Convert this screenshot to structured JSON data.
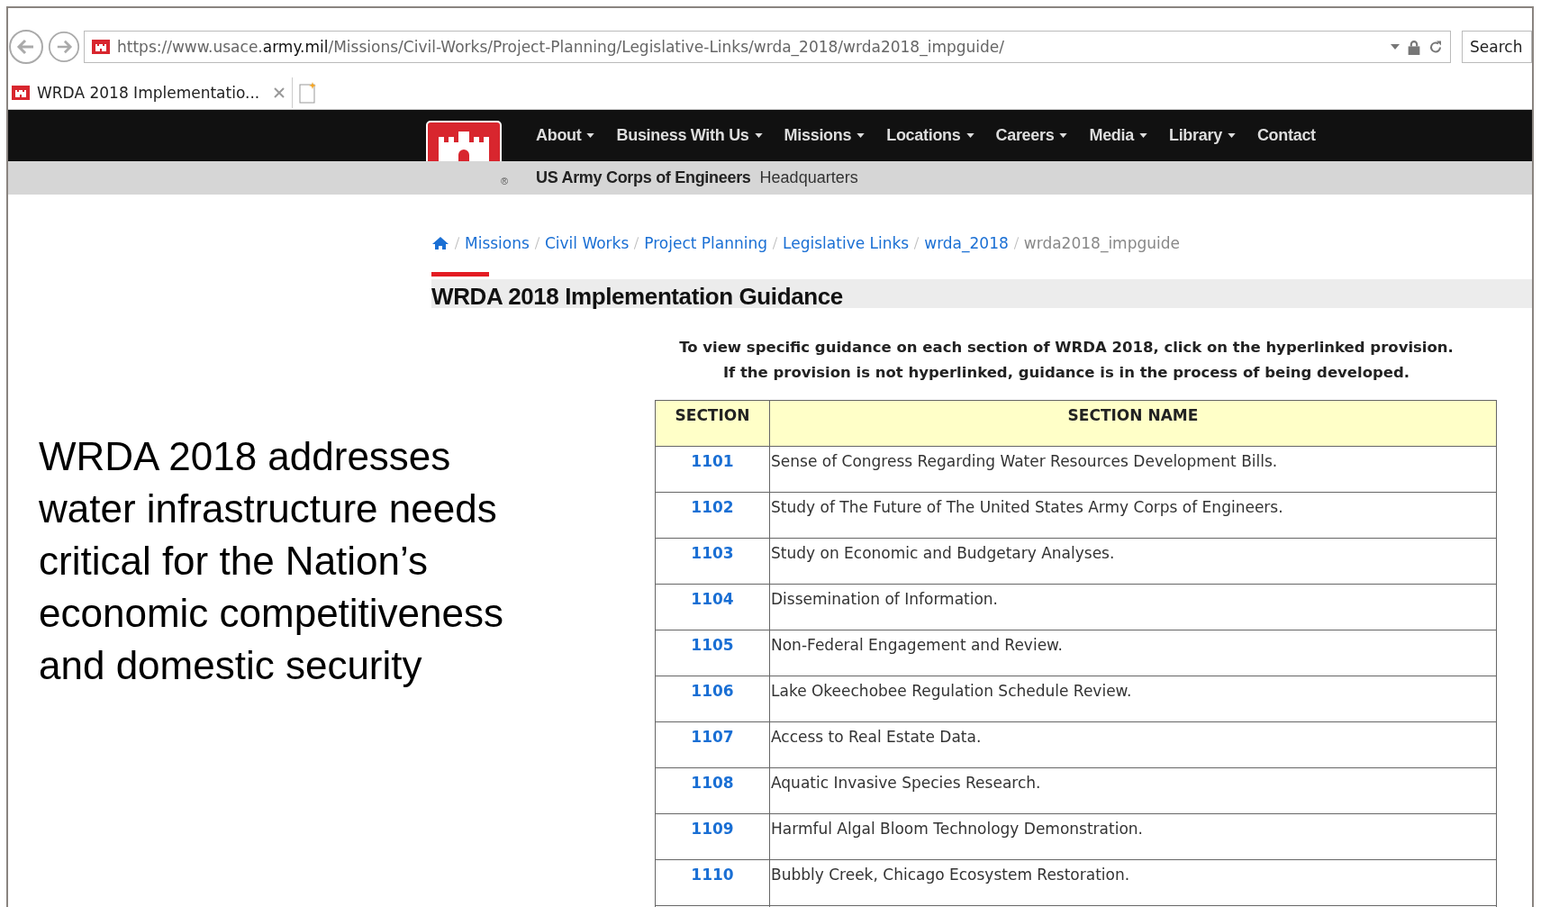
{
  "browser": {
    "url": "https://www.usace.**army.mil**/Missions/Civil-Works/Project-Planning/Legislative-Links/wrda_2018/wrda2018_impguide/",
    "search": {
      "placeholder": "Search"
    },
    "tabs": [
      {
        "title": "WRDA 2018 Implementatio...",
        "selected": true
      }
    ]
  },
  "site_nav": {
    "items": [
      {
        "label": "About",
        "dropdown": true
      },
      {
        "label": "Business With Us",
        "dropdown": true
      },
      {
        "label": "Missions",
        "dropdown": true
      },
      {
        "label": "Locations",
        "dropdown": true
      },
      {
        "label": "Careers",
        "dropdown": true
      },
      {
        "label": "Media",
        "dropdown": true
      },
      {
        "label": "Library",
        "dropdown": true
      },
      {
        "label": "Contact",
        "dropdown": false
      }
    ],
    "registered_mark": "®",
    "org_name": "US Army Corps of Engineers",
    "office": "Headquarters"
  },
  "breadcrumb": {
    "links": [
      "Missions",
      "Civil Works",
      "Project Planning",
      "Legislative Links",
      "wrda_2018"
    ],
    "current": "wrda2018_impguide"
  },
  "page_title": "WRDA 2018 Implementation Guidance",
  "instructions": [
    "To view specific guidance on each section of WRDA 2018, click on the hyperlinked provision.",
    "If the provision is not hyperlinked, guidance is in the process of being developed."
  ],
  "table": {
    "columns": [
      "SECTION",
      "SECTION NAME"
    ],
    "rows": [
      {
        "section": "1101",
        "name": "Sense of Congress Regarding Water Resources Development Bills."
      },
      {
        "section": "1102",
        "name": "Study of The Future of The United States Army Corps of Engineers."
      },
      {
        "section": "1103",
        "name": "Study on Economic and Budgetary Analyses."
      },
      {
        "section": "1104",
        "name": "Dissemination of Information."
      },
      {
        "section": "1105",
        "name": "Non-Federal Engagement and Review."
      },
      {
        "section": "1106",
        "name": "Lake Okeechobee Regulation Schedule Review."
      },
      {
        "section": "1107",
        "name": "Access to Real Estate Data."
      },
      {
        "section": "1108",
        "name": "Aquatic Invasive Species Research."
      },
      {
        "section": "1109",
        "name": "Harmful Algal Bloom Technology Demonstration."
      },
      {
        "section": "1110",
        "name": "Bubbly Creek, Chicago Ecosystem Restoration."
      }
    ]
  },
  "slide_caption": "WRDA 2018 addresses water infrastructure needs critical for the Nation’s economic competitiveness and domestic security"
}
